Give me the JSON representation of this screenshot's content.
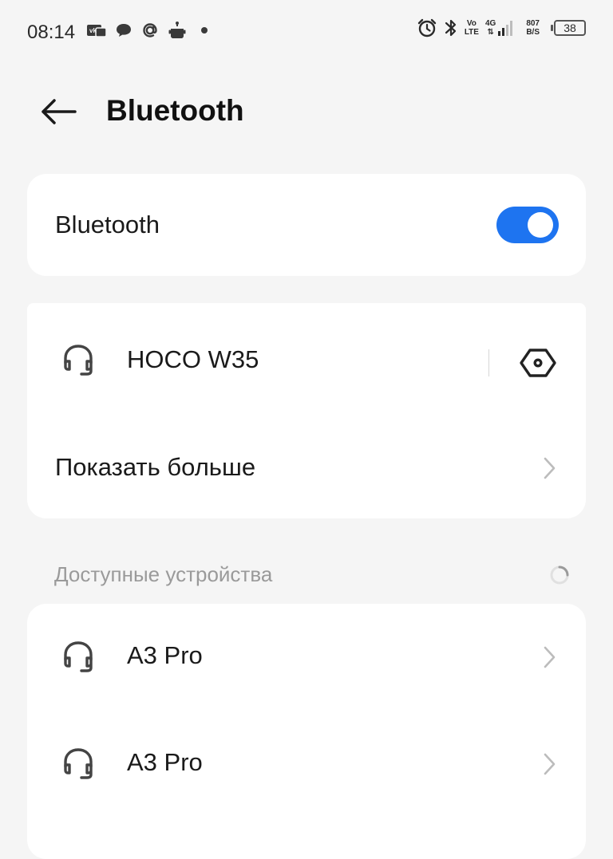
{
  "status_bar": {
    "time": "08:14",
    "network_top": "Vo",
    "network_bottom": "LTE",
    "signal_label": "4G",
    "speed_value": "807",
    "speed_unit": "B/S",
    "battery": "38",
    "notification_icons": [
      "vk-icon",
      "chat-icon",
      "at-icon",
      "robot-icon",
      "dot-icon"
    ],
    "system_icons": [
      "alarm-icon",
      "bluetooth-icon",
      "signal-icon",
      "battery-icon"
    ]
  },
  "header": {
    "title": "Bluetooth"
  },
  "bluetooth_toggle": {
    "label": "Bluetooth",
    "enabled": true,
    "accent": "#1e74f0"
  },
  "paired": {
    "devices": [
      {
        "name": "HOCO W35",
        "icon": "headset-icon"
      }
    ],
    "show_more_label": "Показать больше"
  },
  "available": {
    "section_title": "Доступные устройства",
    "devices": [
      {
        "name": "A3 Pro",
        "icon": "headset-icon"
      },
      {
        "name": "A3 Pro",
        "icon": "headset-icon"
      }
    ]
  }
}
